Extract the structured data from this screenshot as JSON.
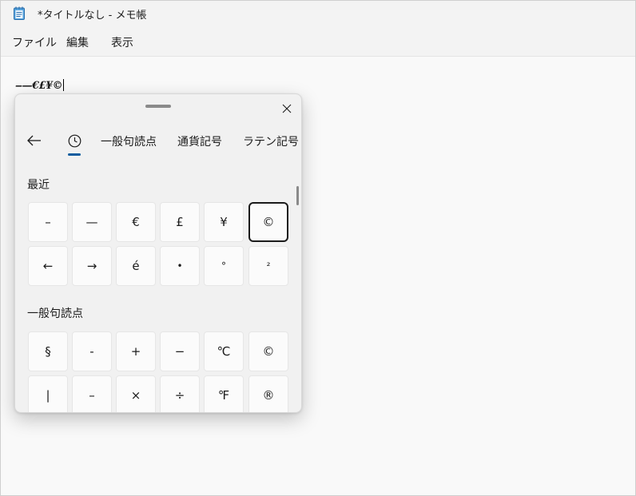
{
  "window": {
    "title": "*タイトルなし - メモ帳"
  },
  "menu": [
    "ファイル",
    "編集",
    "表示"
  ],
  "editor": {
    "content": "‒—€£¥©"
  },
  "panel": {
    "tabs": [
      "一般句読点",
      "通貨記号",
      "ラテン記号"
    ],
    "recent": {
      "title": "最近",
      "rows": [
        [
          "–",
          "—",
          "€",
          "£",
          "¥",
          "©"
        ],
        [
          "←",
          "→",
          "é",
          "•",
          "°",
          "²"
        ]
      ],
      "selected": [
        0,
        5
      ]
    },
    "general": {
      "title": "一般句読点",
      "rows": [
        [
          "§",
          "-",
          "+",
          "−",
          "℃",
          "©"
        ],
        [
          "|",
          "–",
          "×",
          "÷",
          "℉",
          "®"
        ]
      ]
    }
  }
}
